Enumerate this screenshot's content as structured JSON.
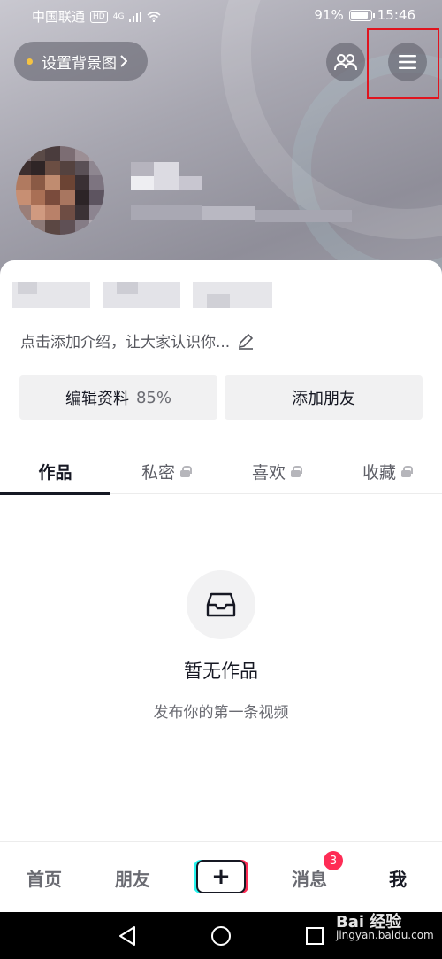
{
  "status_bar": {
    "carrier": "中国联通",
    "hd": "HD",
    "network": "4G",
    "battery_percent": "91%",
    "time": "15:46"
  },
  "header": {
    "set_background_label": "设置背景图"
  },
  "profile": {
    "intro_placeholder": "点击添加介绍，让大家认识你..."
  },
  "actions": {
    "edit_label": "编辑资料",
    "edit_percent": "85%",
    "add_friend_label": "添加朋友"
  },
  "tabs": [
    {
      "label": "作品",
      "active": true,
      "locked": false
    },
    {
      "label": "私密",
      "active": false,
      "locked": true
    },
    {
      "label": "喜欢",
      "active": false,
      "locked": true
    },
    {
      "label": "收藏",
      "active": false,
      "locked": true
    }
  ],
  "empty_state": {
    "title": "暂无作品",
    "subtitle": "发布你的第一条视频",
    "icon": "inbox-icon"
  },
  "bottom_nav": {
    "home": "首页",
    "friends": "朋友",
    "plus": "+",
    "messages": "消息",
    "messages_badge": "3",
    "me": "我"
  },
  "watermark": {
    "brand": "Bai 经验",
    "domain": "jingyan.baidu.com"
  },
  "colors": {
    "accent_red": "#fe2c55",
    "accent_cyan": "#25f4ee",
    "highlight_box": "#e0141e"
  }
}
